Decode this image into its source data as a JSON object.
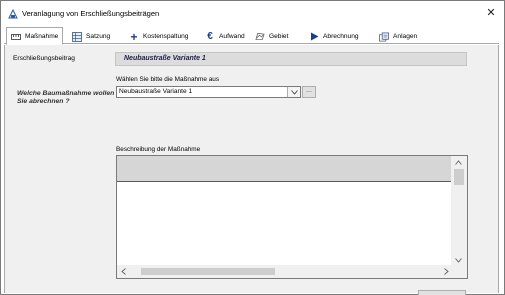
{
  "window": {
    "title": "Veranlagung von Erschließungsbeiträgen",
    "close_label": "✕"
  },
  "tabs": [
    {
      "label": "Maßnahme",
      "icon": "measure-icon",
      "active": true
    },
    {
      "label": "Satzung",
      "icon": "statute-icon",
      "active": false
    },
    {
      "label": "Kostenspaltung",
      "icon": "plus-icon",
      "active": false
    },
    {
      "label": "Aufwand",
      "icon": "euro-icon",
      "active": false
    },
    {
      "label": "Gebiet",
      "icon": "area-icon",
      "active": false
    },
    {
      "label": "Abrechnung",
      "icon": "play-icon",
      "active": false
    },
    {
      "label": "Anlagen",
      "icon": "attachments-icon",
      "active": false
    }
  ],
  "sidebar": {
    "label": "Erschließungsbeitrag",
    "question": "Welche Baumaßnahme wollen Sie abrechnen ?"
  },
  "main": {
    "header": "Neubaustraße Variante 1",
    "choose_label": "Wählen Sie bitte die Maßnahme aus",
    "selected_measure": "Neubaustraße Variante 1",
    "dots_label": "...",
    "description_label": "Beschreibung der Maßnahme"
  },
  "colors": {
    "accent": "#1e1e50",
    "euro": "#1a3f8a",
    "plus": "#1a3f8a"
  }
}
